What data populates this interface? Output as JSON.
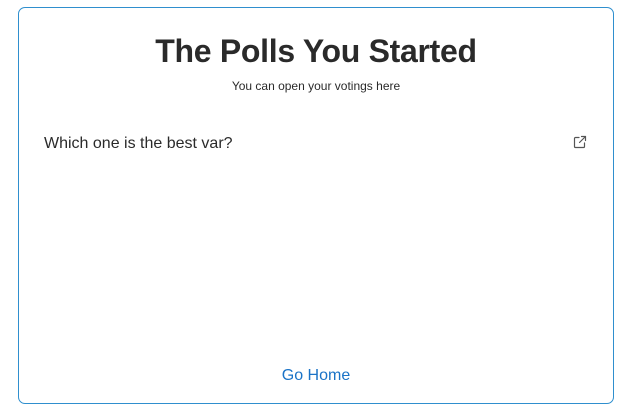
{
  "header": {
    "title": "The Polls You Started",
    "subtitle": "You can open your votings here"
  },
  "polls": [
    {
      "question": "Which one is the best var?",
      "action_icon": "external-link-icon"
    }
  ],
  "footer": {
    "go_home_label": "Go Home"
  },
  "colors": {
    "card_border": "#2f8fce",
    "link": "#1a73c7",
    "text": "#2a2a2a"
  }
}
